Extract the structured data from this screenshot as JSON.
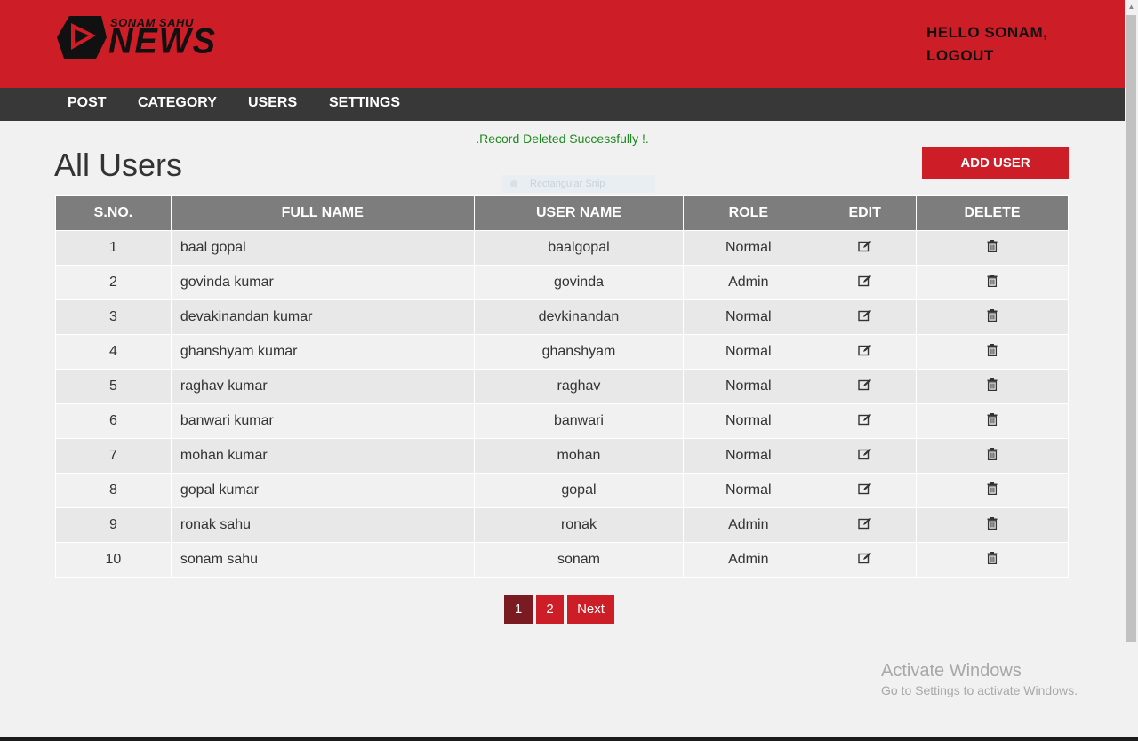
{
  "brand": {
    "logo_small": "SONAM SAHU",
    "logo_big": "NEWS"
  },
  "header": {
    "greeting": "HELLO SONAM,",
    "logout": "LOGOUT"
  },
  "nav": {
    "items": [
      {
        "label": "POST"
      },
      {
        "label": "CATEGORY"
      },
      {
        "label": "USERS"
      },
      {
        "label": "SETTINGS"
      }
    ]
  },
  "main": {
    "message": ".Record Deleted Successfully !.",
    "title": "All Users",
    "add_button": "ADD USER",
    "snip_overlay": "Rectangular Snip"
  },
  "table": {
    "headers": [
      "S.NO.",
      "FULL NAME",
      "USER NAME",
      "ROLE",
      "EDIT",
      "DELETE"
    ],
    "rows": [
      {
        "sno": "1",
        "full_name": "baal gopal",
        "user_name": "baalgopal",
        "role": "Normal"
      },
      {
        "sno": "2",
        "full_name": "govinda kumar",
        "user_name": "govinda",
        "role": "Admin"
      },
      {
        "sno": "3",
        "full_name": "devakinandan kumar",
        "user_name": "devkinandan",
        "role": "Normal"
      },
      {
        "sno": "4",
        "full_name": "ghanshyam kumar",
        "user_name": "ghanshyam",
        "role": "Normal"
      },
      {
        "sno": "5",
        "full_name": "raghav kumar",
        "user_name": "raghav",
        "role": "Normal"
      },
      {
        "sno": "6",
        "full_name": "banwari kumar",
        "user_name": "banwari",
        "role": "Normal"
      },
      {
        "sno": "7",
        "full_name": "mohan kumar",
        "user_name": "mohan",
        "role": "Normal"
      },
      {
        "sno": "8",
        "full_name": "gopal kumar",
        "user_name": "gopal",
        "role": "Normal"
      },
      {
        "sno": "9",
        "full_name": "ronak sahu",
        "user_name": "ronak",
        "role": "Admin"
      },
      {
        "sno": "10",
        "full_name": "sonam sahu",
        "user_name": "sonam",
        "role": "Admin"
      }
    ],
    "edit_icon": "edit-icon",
    "delete_icon": "trash-icon"
  },
  "pagination": {
    "pages": [
      "1",
      "2"
    ],
    "current": "1",
    "next_label": "Next"
  },
  "watermark": {
    "line1": "Activate Windows",
    "line2": "Go to Settings to activate Windows."
  },
  "colors": {
    "brand_red": "#cd1d27",
    "nav_dark": "#383838",
    "header_gray": "#7d7d7d",
    "active_page": "#791b20",
    "success_green": "#1f8a1f"
  }
}
